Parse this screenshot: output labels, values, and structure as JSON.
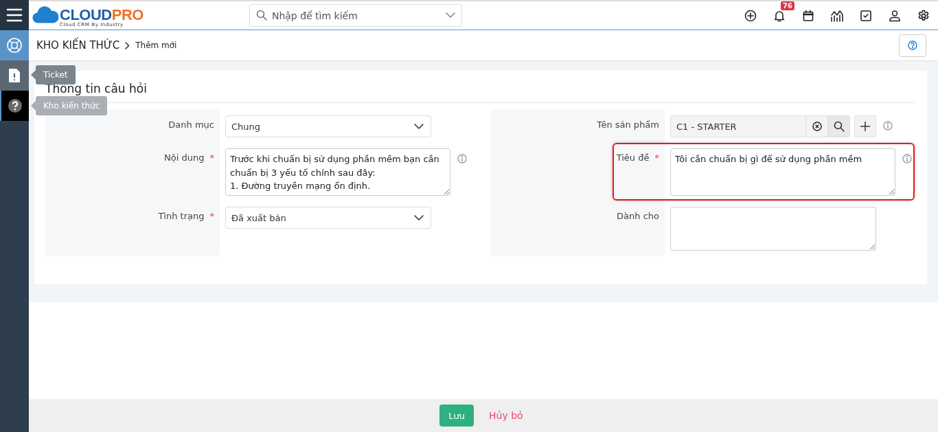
{
  "sidebar": {
    "items": [
      {
        "selected": false,
        "hovered": false
      },
      {
        "selected": true,
        "hovered": false
      },
      {
        "selected": false,
        "hovered": false,
        "tooltip": {
          "text": "Ticket",
          "faded": false
        }
      },
      {
        "selected": false,
        "hovered": true,
        "tooltip": {
          "text": "Kho kiến thức",
          "faded": true
        }
      }
    ]
  },
  "logo": {
    "primary": "CLOUD",
    "accent": "PRO",
    "tagline": "Cloud CRM By Industry"
  },
  "search": {
    "placeholder": "Nhập để tìm kiếm"
  },
  "toolbar": {
    "notification_badge": "76"
  },
  "breadcrumb": {
    "section": "KHO KIẾN THỨC",
    "page": "Thêm mới"
  },
  "form": {
    "title": "Thông tin câu hỏi",
    "columns": [
      [
        {
          "label": "Danh mục",
          "kind": "select",
          "value": "Chung",
          "info": false,
          "highlighted": false
        },
        {
          "label": "Nội dung",
          "kind": "textarea",
          "required_mark": "*",
          "value": "Trước khi chuẩn bị sử dụng phần mềm bạn cần chuẩn bị 3 yếu tố chính sau đây:\n1. Đường truyền mạng ổn định.",
          "info": true,
          "highlighted": false
        },
        {
          "label": "Tình trạng",
          "kind": "select",
          "required_mark": "*",
          "value": "Đã xuất bản",
          "info": false,
          "highlighted": false
        }
      ],
      [
        {
          "label": "Tên sản phẩm",
          "kind": "lookup",
          "value": "C1 - STARTER",
          "info": true,
          "highlighted": false
        },
        {
          "label": "Tiêu đề",
          "kind": "textarea",
          "required_mark": "*",
          "value": "Tôi cần chuẩn bị gì để sử dụng phần mềm",
          "info": true,
          "highlighted": true
        },
        {
          "label": "Dành cho",
          "kind": "textarea",
          "info": false,
          "highlighted": false
        }
      ]
    ]
  },
  "footer": {
    "save": "Lưu",
    "cancel": "Hủy bỏ"
  }
}
